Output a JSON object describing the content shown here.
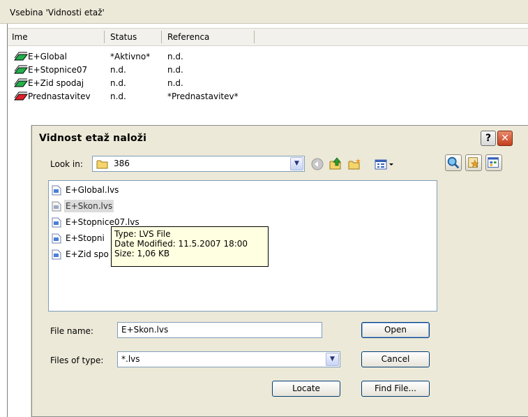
{
  "background_panel": {
    "title": "Vsebina 'Vidnosti etaž'",
    "columns": [
      "Ime",
      "Status",
      "Referenca"
    ],
    "rows": [
      {
        "name": "E+Global",
        "status": "*Aktivno*",
        "reference": "n.d.",
        "icon": "layer-green-icon",
        "color": "#22b14c"
      },
      {
        "name": "E+Stopnice07",
        "status": "n.d.",
        "reference": "n.d.",
        "icon": "layer-green-icon",
        "color": "#22b14c"
      },
      {
        "name": "E+Zid spodaj",
        "status": "n.d.",
        "reference": "n.d.",
        "icon": "layer-green-icon",
        "color": "#22b14c"
      },
      {
        "name": "Prednastavitev",
        "status": "n.d.",
        "reference": "*Prednastavitev*",
        "icon": "layer-red-icon",
        "color": "#e0202a"
      }
    ]
  },
  "dialog": {
    "title": "Vidnost etaž naloži",
    "help_label": "?",
    "close_label": "✕",
    "look_in_label": "Look in:",
    "look_in_value": "386",
    "files": [
      "E+Global.lvs",
      "E+Skon.lvs",
      "E+Stopnice07.lvs",
      "E+Stopnice",
      "E+Zid spodaj.lvs"
    ],
    "files_visible": [
      "E+Global.lvs",
      "E+Skon.lvs",
      "E+Stopnice07.lvs",
      "E+Stopni",
      "E+Zid spo"
    ],
    "selected_file_index": 1,
    "tooltip": {
      "type": "Type: LVS File",
      "modified": "Date Modified: 11.5.2007 18:00",
      "size": "Size: 1,06 KB"
    },
    "file_name_label": "File name:",
    "file_name_value": "E+Skon.lvs",
    "files_of_type_label": "Files of type:",
    "files_of_type_value": "*.lvs",
    "open_label": "Open",
    "cancel_label": "Cancel",
    "locate_label": "Locate",
    "find_file_label": "Find File..."
  },
  "colors": {
    "dialog_bg": "#ece9d8",
    "tooltip_bg": "#ffffe1",
    "field_border": "#7f9db9"
  }
}
